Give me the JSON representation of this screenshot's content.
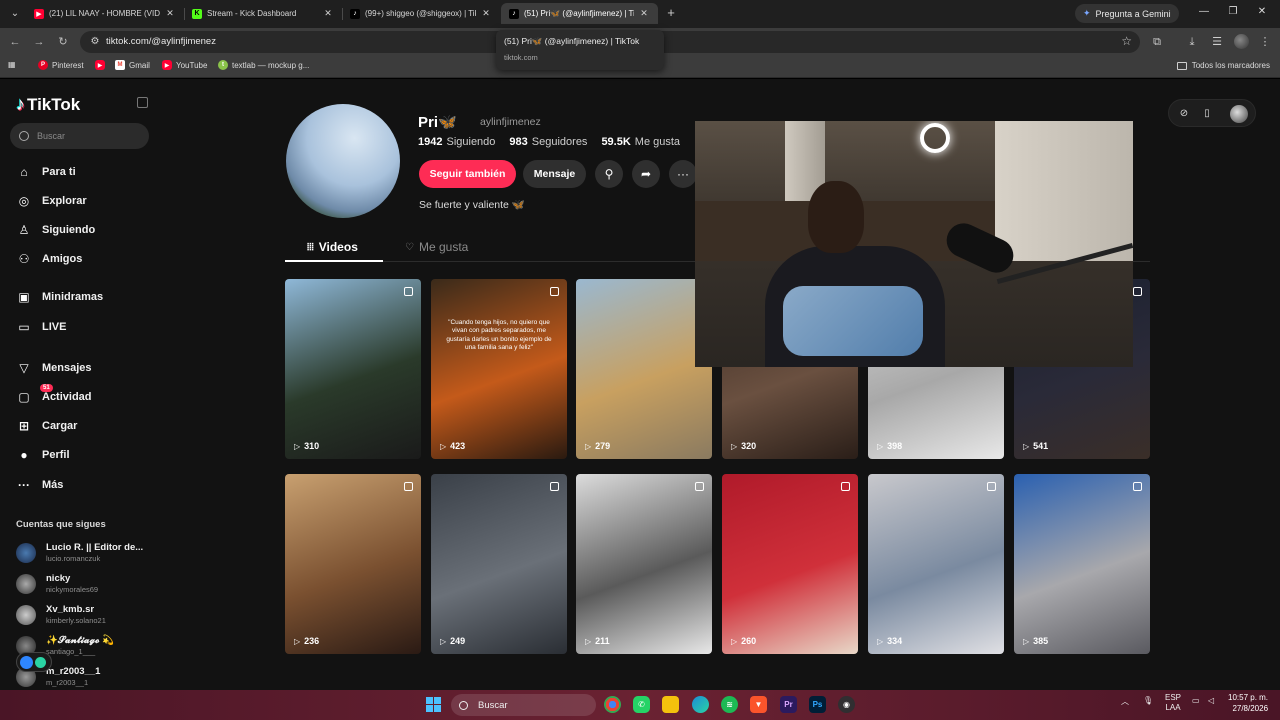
{
  "browser": {
    "tabs": [
      {
        "title": "(21) LIL NAAY - HOMBRE (VIDE...",
        "icon": "youtube-icon",
        "color": "#ff0033",
        "active": false
      },
      {
        "title": "Stream - Kick Dashboard",
        "icon": "kick-icon",
        "color": "#53fc18",
        "active": false
      },
      {
        "title": "(99+) shiggeo (@shiggeox) | TikTok",
        "icon": "tiktok-icon",
        "color": "#000000",
        "active": false
      },
      {
        "title": "(51) Pri🦋 (@aylinfjimenez) | TikTok",
        "icon": "tiktok-icon",
        "color": "#000000",
        "active": true
      }
    ],
    "gemini_label": "Pregunta a Gemini",
    "url": "tiktok.com/@aylinfjimenez",
    "tooltip": {
      "title": "(51) Pri🦋 (@aylinfjimenez) | TikTok",
      "domain": "tiktok.com"
    },
    "bookmarks": [
      {
        "label": "Pinterest",
        "color": "#e60023"
      },
      {
        "label": "",
        "color": "#ff0033"
      },
      {
        "label": "Gmail",
        "color": "#ea4335"
      },
      {
        "label": "YouTube",
        "color": "#ff0033"
      },
      {
        "label": "textlab — mockup g...",
        "color": "#8bc34a"
      }
    ],
    "all_bookmarks_label": "Todos los marcadores"
  },
  "sidebar": {
    "logo": "TikTok",
    "search_placeholder": "Buscar",
    "nav": [
      {
        "label": "Para ti",
        "icon": "home-icon"
      },
      {
        "label": "Explorar",
        "icon": "compass-icon"
      },
      {
        "label": "Siguiendo",
        "icon": "following-icon"
      },
      {
        "label": "Amigos",
        "icon": "friends-icon"
      },
      {
        "label": "Minidramas",
        "icon": "minidramas-icon"
      },
      {
        "label": "LIVE",
        "icon": "live-icon"
      },
      {
        "label": "Mensajes",
        "icon": "messages-icon"
      },
      {
        "label": "Actividad",
        "icon": "activity-icon",
        "badge": "51"
      },
      {
        "label": "Cargar",
        "icon": "upload-icon"
      },
      {
        "label": "Perfil",
        "icon": "profile-icon"
      },
      {
        "label": "Más",
        "icon": "more-icon"
      }
    ],
    "following_title": "Cuentas que sigues",
    "following": [
      {
        "name": "Lucio R. || Editor de...",
        "handle": "lucio.romanczuk"
      },
      {
        "name": "nicky",
        "handle": "nickymorales69"
      },
      {
        "name": "Xv_kmb.sr",
        "handle": "kimberly.solano21"
      },
      {
        "name": "✨𝓢𝓪𝓷𝓽𝓲𝓪𝓰𝓸 💫",
        "handle": "santiago_1___"
      },
      {
        "name": "m_r2003__1",
        "handle": "m_r2003__1"
      }
    ]
  },
  "profile": {
    "name": "Pri🦋",
    "handle": "aylinfjimenez",
    "following_count": "1942",
    "following_label": "Siguiendo",
    "followers_count": "983",
    "followers_label": "Seguidores",
    "likes_count": "59.5K",
    "likes_label": "Me gusta",
    "follow_back_label": "Seguir también",
    "message_label": "Mensaje",
    "bio": "Se fuerte y valiente 🦋",
    "tabs": [
      {
        "label": "Videos"
      },
      {
        "label": "Me gusta"
      }
    ]
  },
  "videos": [
    {
      "views": "310",
      "caption": "",
      "colors": [
        "#8fb8d8",
        "#2a3a2a",
        "#1a1a1a"
      ]
    },
    {
      "views": "423",
      "caption": "\"Cuando tenga hijos, no quiero que vivan con padres separados, me gustaría darles un bonito ejemplo de una familia sana y feliz\"",
      "colors": [
        "#3a2a1a",
        "#c45a1a",
        "#2a1a10"
      ]
    },
    {
      "views": "279",
      "caption": "",
      "colors": [
        "#9ab8d0",
        "#c8a060",
        "#8a7a60"
      ]
    },
    {
      "views": "320",
      "caption": "",
      "colors": [
        "#3a2a22",
        "#6a5040",
        "#2a1e18"
      ]
    },
    {
      "views": "398",
      "caption": "",
      "colors": [
        "#d8d8d8",
        "#a8a8a8",
        "#e8e8e8"
      ]
    },
    {
      "views": "541",
      "caption": "",
      "colors": [
        "#1a2030",
        "#2a2a38",
        "#3a2e28"
      ]
    },
    {
      "views": "236",
      "caption": "",
      "colors": [
        "#c8a070",
        "#7a5030",
        "#2a1a14"
      ]
    },
    {
      "views": "249",
      "caption": "",
      "colors": [
        "#3a4048",
        "#6a7078",
        "#2a2e34"
      ]
    },
    {
      "views": "211",
      "caption": "",
      "colors": [
        "#dcdcdc",
        "#5a5a5a",
        "#e8e8e8"
      ]
    },
    {
      "views": "260",
      "caption": "",
      "colors": [
        "#b01a2a",
        "#d0303a",
        "#e8d8c8"
      ]
    },
    {
      "views": "334",
      "caption": "",
      "colors": [
        "#c8c8cc",
        "#7a8aa0",
        "#e0e0e4"
      ]
    },
    {
      "views": "385",
      "caption": "",
      "colors": [
        "#2a60b0",
        "#a8a8ac",
        "#5a5a60"
      ]
    }
  ],
  "taskbar": {
    "search_label": "Buscar",
    "apps": [
      {
        "name": "chrome",
        "color": "#34a853"
      },
      {
        "name": "whatsapp",
        "color": "#25d366"
      },
      {
        "name": "explorer",
        "color": "#f4c20d"
      },
      {
        "name": "edge",
        "color": "#1c8cd6"
      },
      {
        "name": "spotify",
        "color": "#1db954"
      },
      {
        "name": "brave",
        "color": "#fb542b"
      },
      {
        "name": "premiere",
        "color": "#2b1a5e",
        "text": "Pr"
      },
      {
        "name": "photoshop",
        "color": "#001e36",
        "text": "Ps"
      },
      {
        "name": "obs",
        "color": "#302e31"
      }
    ],
    "lang_top": "ESP",
    "lang_bottom": "LAA",
    "time": "10:57 p. m.",
    "date": "27/8/2026"
  }
}
